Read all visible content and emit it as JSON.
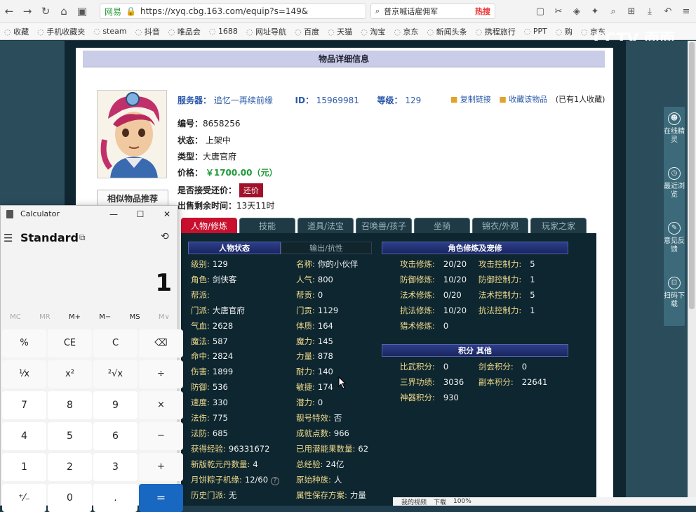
{
  "browser": {
    "site_tag": "网易",
    "url": "https://xyq.cbg.163.com/equip?s=149&",
    "search_text": "普京喊话雇佣军",
    "search_hot": "热搜",
    "bookmarks": [
      "收藏",
      "手机收藏夹",
      "steam",
      "抖音",
      "唯品会",
      "1688",
      "网址导航",
      "百度",
      "天猫",
      "淘宝",
      "京东",
      "新闻头条",
      "携程旅行",
      "PPT",
      "购",
      "京东"
    ]
  },
  "watermark": "CCTV 面面",
  "page": {
    "title": "物品详细信息",
    "server_label": "服务器：",
    "server_value": "追忆一再续前缘",
    "id_label": "ID：",
    "id_value": "15969981",
    "level_label": "等级：",
    "level_value": "129",
    "copy_link": "复制链接",
    "collect": "收藏该物品",
    "collect_count": "(已有1人收藏)",
    "number_label": "编号：",
    "number_value": "8658256",
    "status_label": "状态：",
    "status_value": "上架中",
    "type_label": "类型：",
    "type_value": "大唐官府",
    "price_label": "价格：",
    "price_value": "￥1700.00（元）",
    "bargain_label": "是否接受还价：",
    "bargain_button": "还价",
    "remaining_label": "出售剩余时间：",
    "remaining_value": "13天11时",
    "similar_button": "相似物品推荐"
  },
  "tabs": [
    "人物/修炼",
    "技能",
    "道具/法宝",
    "召唤兽/孩子",
    "坐骑",
    "锦衣/外观",
    "玩家之家"
  ],
  "sections": {
    "char_status": "人物状态",
    "output_resist": "输出/抗性",
    "cultivation": "角色修炼及宠修",
    "points": "积分 其他"
  },
  "left_col": [
    {
      "label": "级别:",
      "value": "129"
    },
    {
      "label": "角色:",
      "value": "剑侠客"
    },
    {
      "label": "帮派:",
      "value": ""
    },
    {
      "label": "门派:",
      "value": "大唐官府"
    },
    {
      "label": "气血:",
      "value": "2628"
    },
    {
      "label": "魔法:",
      "value": "587"
    },
    {
      "label": "命中:",
      "value": "2824"
    },
    {
      "label": "伤害:",
      "value": "1899"
    },
    {
      "label": "防御:",
      "value": "536"
    },
    {
      "label": "速度:",
      "value": "330"
    },
    {
      "label": "法伤:",
      "value": "775"
    },
    {
      "label": "法防:",
      "value": "685"
    },
    {
      "label": "获得经验:",
      "value": "96331672"
    },
    {
      "label": "新版乾元丹数量:",
      "value": "4"
    },
    {
      "label": "月饼粽子机缘:",
      "value": "12/60"
    },
    {
      "label": "历史门派:",
      "value": "无"
    }
  ],
  "mid_col": [
    {
      "label": "名称:",
      "value": "你的小伙伴"
    },
    {
      "label": "人气:",
      "value": "800"
    },
    {
      "label": "帮贡:",
      "value": "0"
    },
    {
      "label": "门贡:",
      "value": "1129"
    },
    {
      "label": "体质:",
      "value": "164"
    },
    {
      "label": "魔力:",
      "value": "145"
    },
    {
      "label": "力量:",
      "value": "878"
    },
    {
      "label": "耐力:",
      "value": "140"
    },
    {
      "label": "敏捷:",
      "value": "174"
    },
    {
      "label": "潜力:",
      "value": "0"
    },
    {
      "label": "靓号特效:",
      "value": "否"
    },
    {
      "label": "成就点数:",
      "value": "966"
    },
    {
      "label": "已用潜能果数量:",
      "value": "62"
    },
    {
      "label": "总经验:",
      "value": "24亿"
    },
    {
      "label": "原始种族:",
      "value": "人"
    },
    {
      "label": "属性保存方案:",
      "value": "力量"
    }
  ],
  "cultivation": [
    {
      "l1": "攻击修炼:",
      "v1": "20/20",
      "l2": "攻击控制力:",
      "v2": "5"
    },
    {
      "l1": "防御修炼:",
      "v1": "10/20",
      "l2": "防御控制力:",
      "v2": "1"
    },
    {
      "l1": "法术修炼:",
      "v1": "0/20",
      "l2": "法术控制力:",
      "v2": "5"
    },
    {
      "l1": "抗法修炼:",
      "v1": "10/20",
      "l2": "抗法控制力:",
      "v2": "1"
    },
    {
      "l1": "猎术修炼:",
      "v1": "0",
      "l2": "",
      "v2": ""
    }
  ],
  "points": [
    {
      "l1": "比武积分:",
      "v1": "0",
      "l2": "剑会积分:",
      "v2": "0"
    },
    {
      "l1": "三界功绩:",
      "v1": "3036",
      "l2": "副本积分:",
      "v2": "22641"
    },
    {
      "l1": "神器积分:",
      "v1": "930",
      "l2": "",
      "v2": ""
    }
  ],
  "float_panel": [
    {
      "icon": "☻",
      "label": "在线精灵"
    },
    {
      "icon": "◷",
      "label": "最近浏览"
    },
    {
      "icon": "✎",
      "label": "意见反馈"
    },
    {
      "icon": "⊡",
      "label": "扫码下载"
    }
  ],
  "calculator": {
    "title": "Calculator",
    "mode": "Standard",
    "display": "1",
    "memory": [
      "MC",
      "MR",
      "M+",
      "M−",
      "MS",
      "M∨"
    ],
    "keys": [
      [
        "%",
        "CE",
        "C",
        "⌫"
      ],
      [
        "¹⁄x",
        "x²",
        "²√x",
        "÷"
      ],
      [
        "7",
        "8",
        "9",
        "×"
      ],
      [
        "4",
        "5",
        "6",
        "−"
      ],
      [
        "1",
        "2",
        "3",
        "+"
      ],
      [
        "⁺⁄₋",
        "0",
        ".",
        "="
      ]
    ]
  },
  "statusbar": {
    "video": "我的视频",
    "download": "下载",
    "zoom": "100%"
  }
}
